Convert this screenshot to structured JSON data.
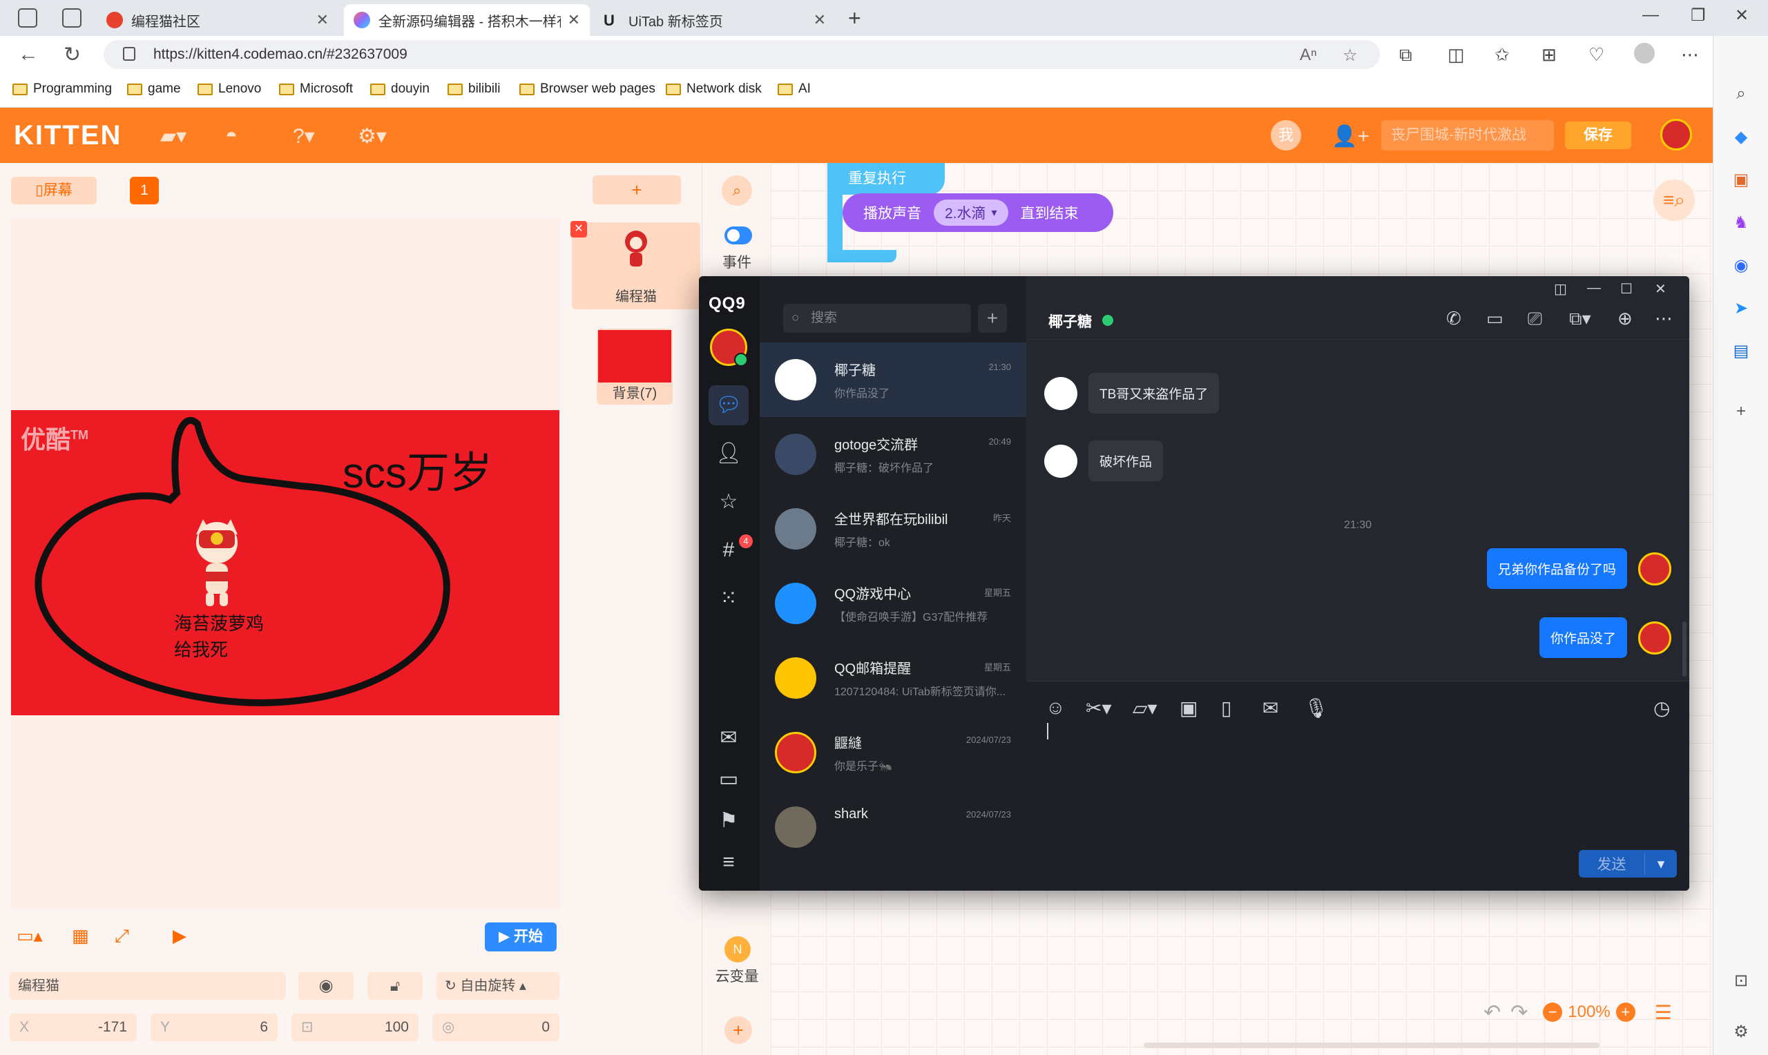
{
  "browser": {
    "tabs": [
      {
        "title": "编程猫社区",
        "active": false,
        "favicon_color": "#e7412d"
      },
      {
        "title": "全新源码编辑器 - 搭积木一样有趣",
        "active": true,
        "favicon_color": "#8c6cff"
      },
      {
        "title": "UiTab 新标签页",
        "active": false,
        "favicon_color": "#222222"
      }
    ],
    "address": "https://kitten4.codemao.cn/#232637009",
    "bookmarks": [
      "Programming",
      "game",
      "Lenovo",
      "Microsoft",
      "douyin",
      "bilibili",
      "Browser web pages",
      "Network disk",
      "AI"
    ]
  },
  "kitten": {
    "logo": "KITTEN",
    "me_badge": "我",
    "work_name_placeholder": "丧尸围城-新时代激战",
    "save_label": "保存",
    "screen_btn": "屏幕",
    "scene_badge": "1",
    "stage": {
      "watermark": "优酷",
      "watermark_tm": "TM",
      "headline": "scs万岁",
      "caption_line1": "海苔菠萝鸡",
      "caption_line2": "给我死"
    },
    "start_label": "开始",
    "sprite": {
      "name": "编程猫",
      "rotate_label": "自由旋转"
    },
    "props": {
      "x_label": "X",
      "x": "-171",
      "y_label": "Y",
      "y": "6",
      "size": "100",
      "direction": "0"
    },
    "sprite_cards": [
      {
        "name": "编程猫"
      },
      {
        "name": "背景(7)"
      }
    ],
    "add_symbol": "+",
    "category_event": "事件",
    "category_cloud": "云变量",
    "cloud_icon_text": "N",
    "blocks": {
      "repeat": "重复执行",
      "play_sound": "播放声音",
      "sound_option": "2.水滴",
      "until_end": "直到结束"
    },
    "zoom": "100%"
  },
  "qq": {
    "logo": "QQ9",
    "nav_badge": "4",
    "search_placeholder": "搜索",
    "conversations": [
      {
        "name": "椰子糖",
        "time": "21:30",
        "last": "你作品没了",
        "avatar_color": "#ffffff",
        "selected": true
      },
      {
        "name": "gotoge交流群",
        "time": "20:49",
        "last": "椰子糖：破坏作品了",
        "avatar_color": "#3a4a66",
        "selected": false
      },
      {
        "name": "全世界都在玩bilibil",
        "time": "昨天",
        "last": "椰子糖：ok",
        "avatar_color": "#6b7b8c",
        "selected": false
      },
      {
        "name": "QQ游戏中心",
        "time": "星期五",
        "last": "【使命召唤手游】G37配件推荐",
        "avatar_color": "#1e90ff",
        "selected": false
      },
      {
        "name": "QQ邮箱提醒",
        "time": "星期五",
        "last": "1207120484: UiTab新标签页请你...",
        "avatar_color": "#ffc400",
        "selected": false
      },
      {
        "name": "鼴縫",
        "time": "2024/07/23",
        "last": "你是乐子🐜",
        "avatar_color": "#d72a2a",
        "selected": false
      },
      {
        "name": "shark",
        "time": "2024/07/23",
        "last": "",
        "avatar_color": "#6f6a5c",
        "selected": false
      }
    ],
    "chat": {
      "title": "椰子糖",
      "messages_in": [
        "TB哥又来盗作品了",
        "破坏作品"
      ],
      "time_sep": "21:30",
      "messages_out": [
        "兄弟你作品备份了吗",
        "你作品没了"
      ]
    },
    "send_label": "发送"
  }
}
